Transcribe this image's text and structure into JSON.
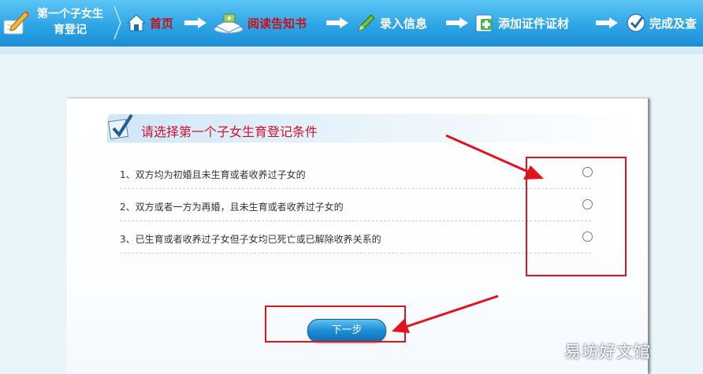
{
  "header": {
    "brand_title": "第一个子女生育登记",
    "steps": [
      {
        "label": "首页",
        "icon": "home-icon",
        "current": true
      },
      {
        "label": "阅读告知书",
        "icon": "book-icon",
        "current": true
      },
      {
        "label": "录入信息",
        "icon": "pencil-icon",
        "current": false
      },
      {
        "label": "添加证件证材",
        "icon": "add-document-icon",
        "current": false
      },
      {
        "label": "完成及查",
        "icon": "check-circle-icon",
        "current": false
      }
    ]
  },
  "main": {
    "panel_title": "请选择第一个子女生育登记条件",
    "options": [
      {
        "label": "1、双方均为初婚且未生育或者收养过子女的",
        "selected": false
      },
      {
        "label": "2、双方或者一方为再婚，且未生育或者收养过子女的",
        "selected": false
      },
      {
        "label": "3、已生育或者收养过子女但子女均已死亡或已解除收养关系的",
        "selected": false
      }
    ],
    "next_button": "下一步"
  },
  "watermark": "易坊好文馆",
  "colors": {
    "header_blue": "#2fa6e6",
    "current_step_red": "#c8101c",
    "title_red": "#d0122a",
    "annotation_red": "#e0141e",
    "button_blue": "#1c8fd6"
  }
}
